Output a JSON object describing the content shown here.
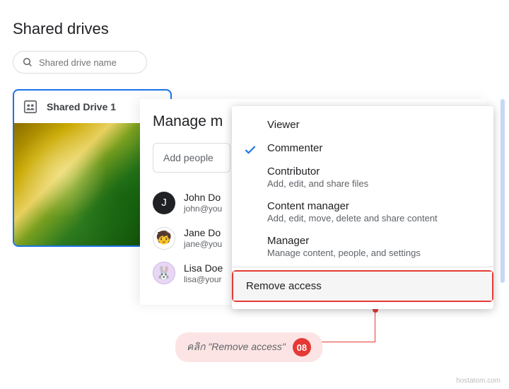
{
  "page": {
    "title": "Shared drives"
  },
  "search": {
    "placeholder": "Shared drive name"
  },
  "drive": {
    "name": "Shared Drive 1"
  },
  "manage": {
    "title": "Manage m",
    "add_placeholder": "Add people",
    "members": [
      {
        "name": "John Do",
        "email": "john@you",
        "initial": "J"
      },
      {
        "name": "Jane Do",
        "email": "jane@you"
      },
      {
        "name": "Lisa Doe",
        "email": "lisa@your"
      }
    ]
  },
  "roles": {
    "viewer": {
      "title": "Viewer"
    },
    "commenter": {
      "title": "Commenter",
      "selected": true
    },
    "contributor": {
      "title": "Contributor",
      "desc": "Add, edit, and share files"
    },
    "content_manager": {
      "title": "Content manager",
      "desc": "Add, edit, move, delete and share content"
    },
    "manager": {
      "title": "Manager",
      "desc": "Manage content, people, and settings"
    },
    "remove": {
      "title": "Remove access"
    }
  },
  "callout": {
    "text": "คลิก \"Remove access\"",
    "num": "08"
  },
  "watermark": "hostatom.com"
}
